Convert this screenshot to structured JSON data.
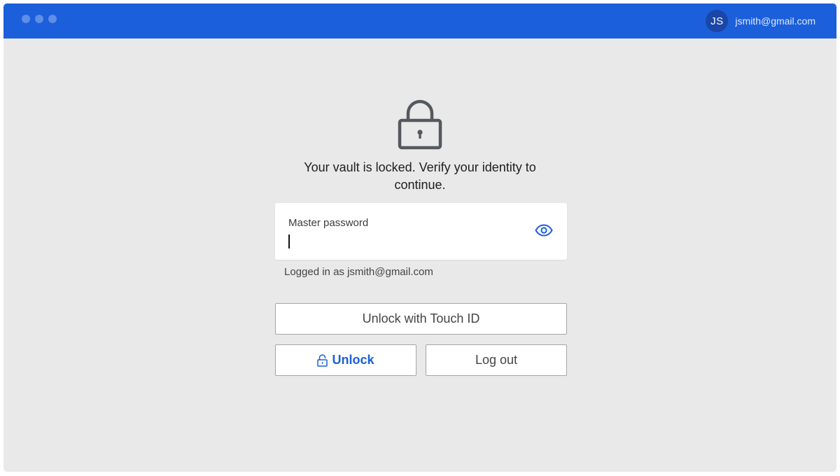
{
  "titlebar": {
    "account": {
      "initials": "JS",
      "email": "jsmith@gmail.com"
    },
    "colors": {
      "brand": "#1b5fda"
    }
  },
  "lock_screen": {
    "icon": "lock-icon",
    "message": "Your vault is locked. Verify your identity to continue.",
    "password_field": {
      "label": "Master password",
      "value": "",
      "toggle_icon": "eye-icon"
    },
    "logged_in_text": "Logged in as jsmith@gmail.com",
    "buttons": {
      "touch_id": "Unlock with Touch ID",
      "unlock": "Unlock",
      "unlock_icon": "unlock-icon",
      "logout": "Log out"
    }
  }
}
